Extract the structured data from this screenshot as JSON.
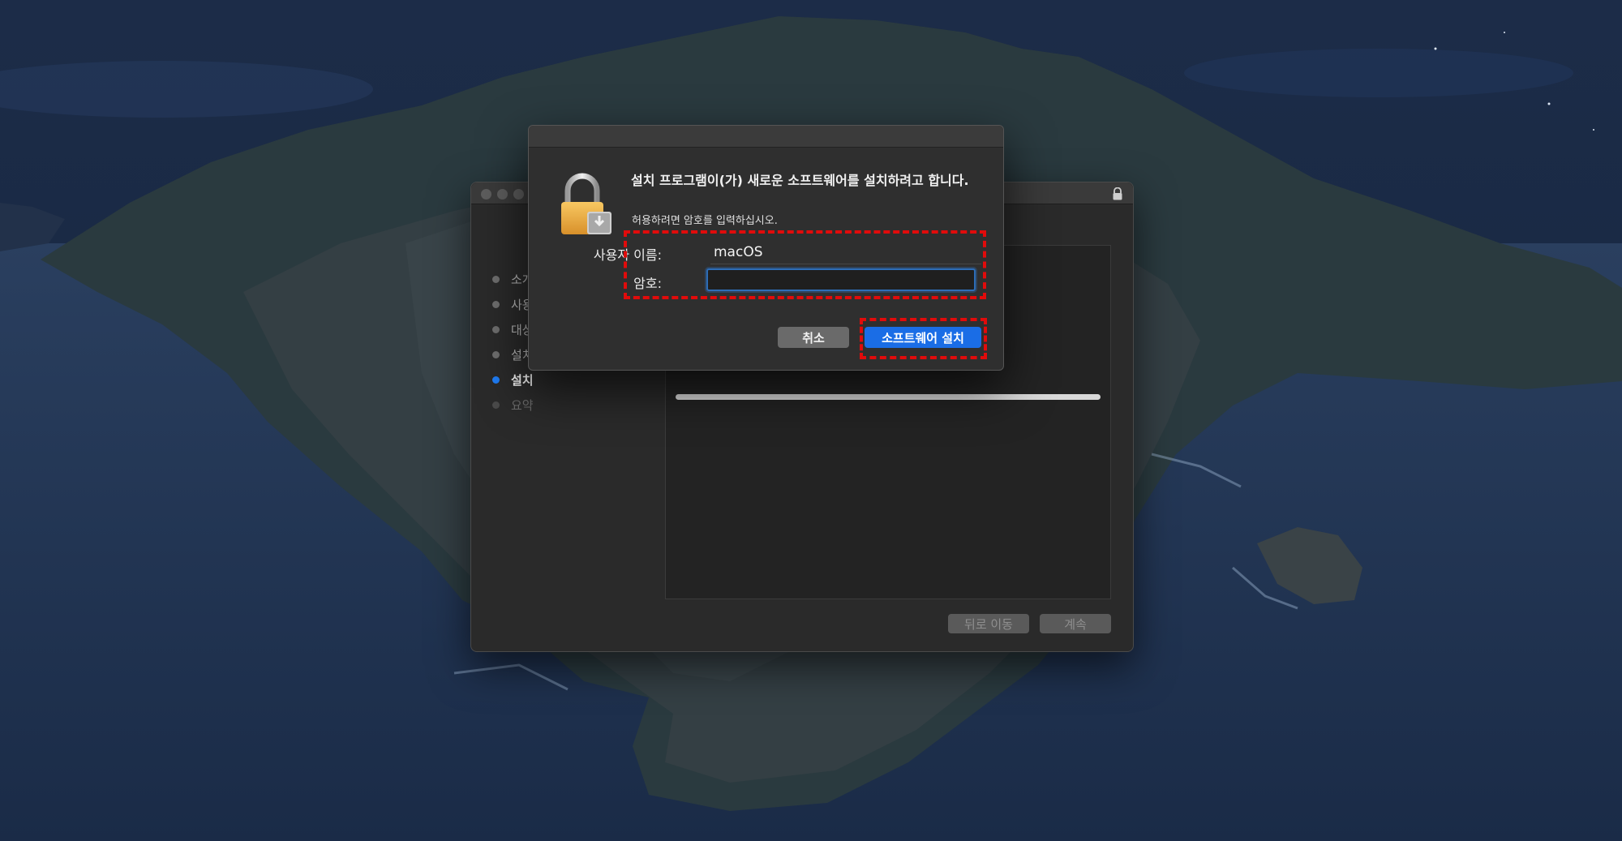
{
  "installer": {
    "steps": [
      {
        "label": "소개",
        "state": "done"
      },
      {
        "label": "사용",
        "state": "done"
      },
      {
        "label": "대상",
        "state": "done"
      },
      {
        "label": "설치",
        "state": "done"
      },
      {
        "label": "설치",
        "state": "active"
      },
      {
        "label": "요약",
        "state": "pending"
      }
    ],
    "progress": 1.0,
    "back_label": "뒤로 이동",
    "continue_label": "계속"
  },
  "auth_dialog": {
    "heading": "설치 프로그램이(가) 새로운 소프트웨어를 설치하려고 합니다.",
    "subtext": "허용하려면 암호를 입력하십시오.",
    "username_label": "사용자 이름:",
    "username_value": "macOS",
    "password_label": "암호:",
    "password_value": "",
    "cancel_label": "취소",
    "install_label": "소프트웨어 설치"
  },
  "icons": {
    "lock": "lock-icon",
    "window_lock": "lock-icon"
  },
  "colors": {
    "accent_blue": "#1a6de6",
    "highlight_red": "#e10b0b",
    "focus_ring": "#2d6db7"
  }
}
